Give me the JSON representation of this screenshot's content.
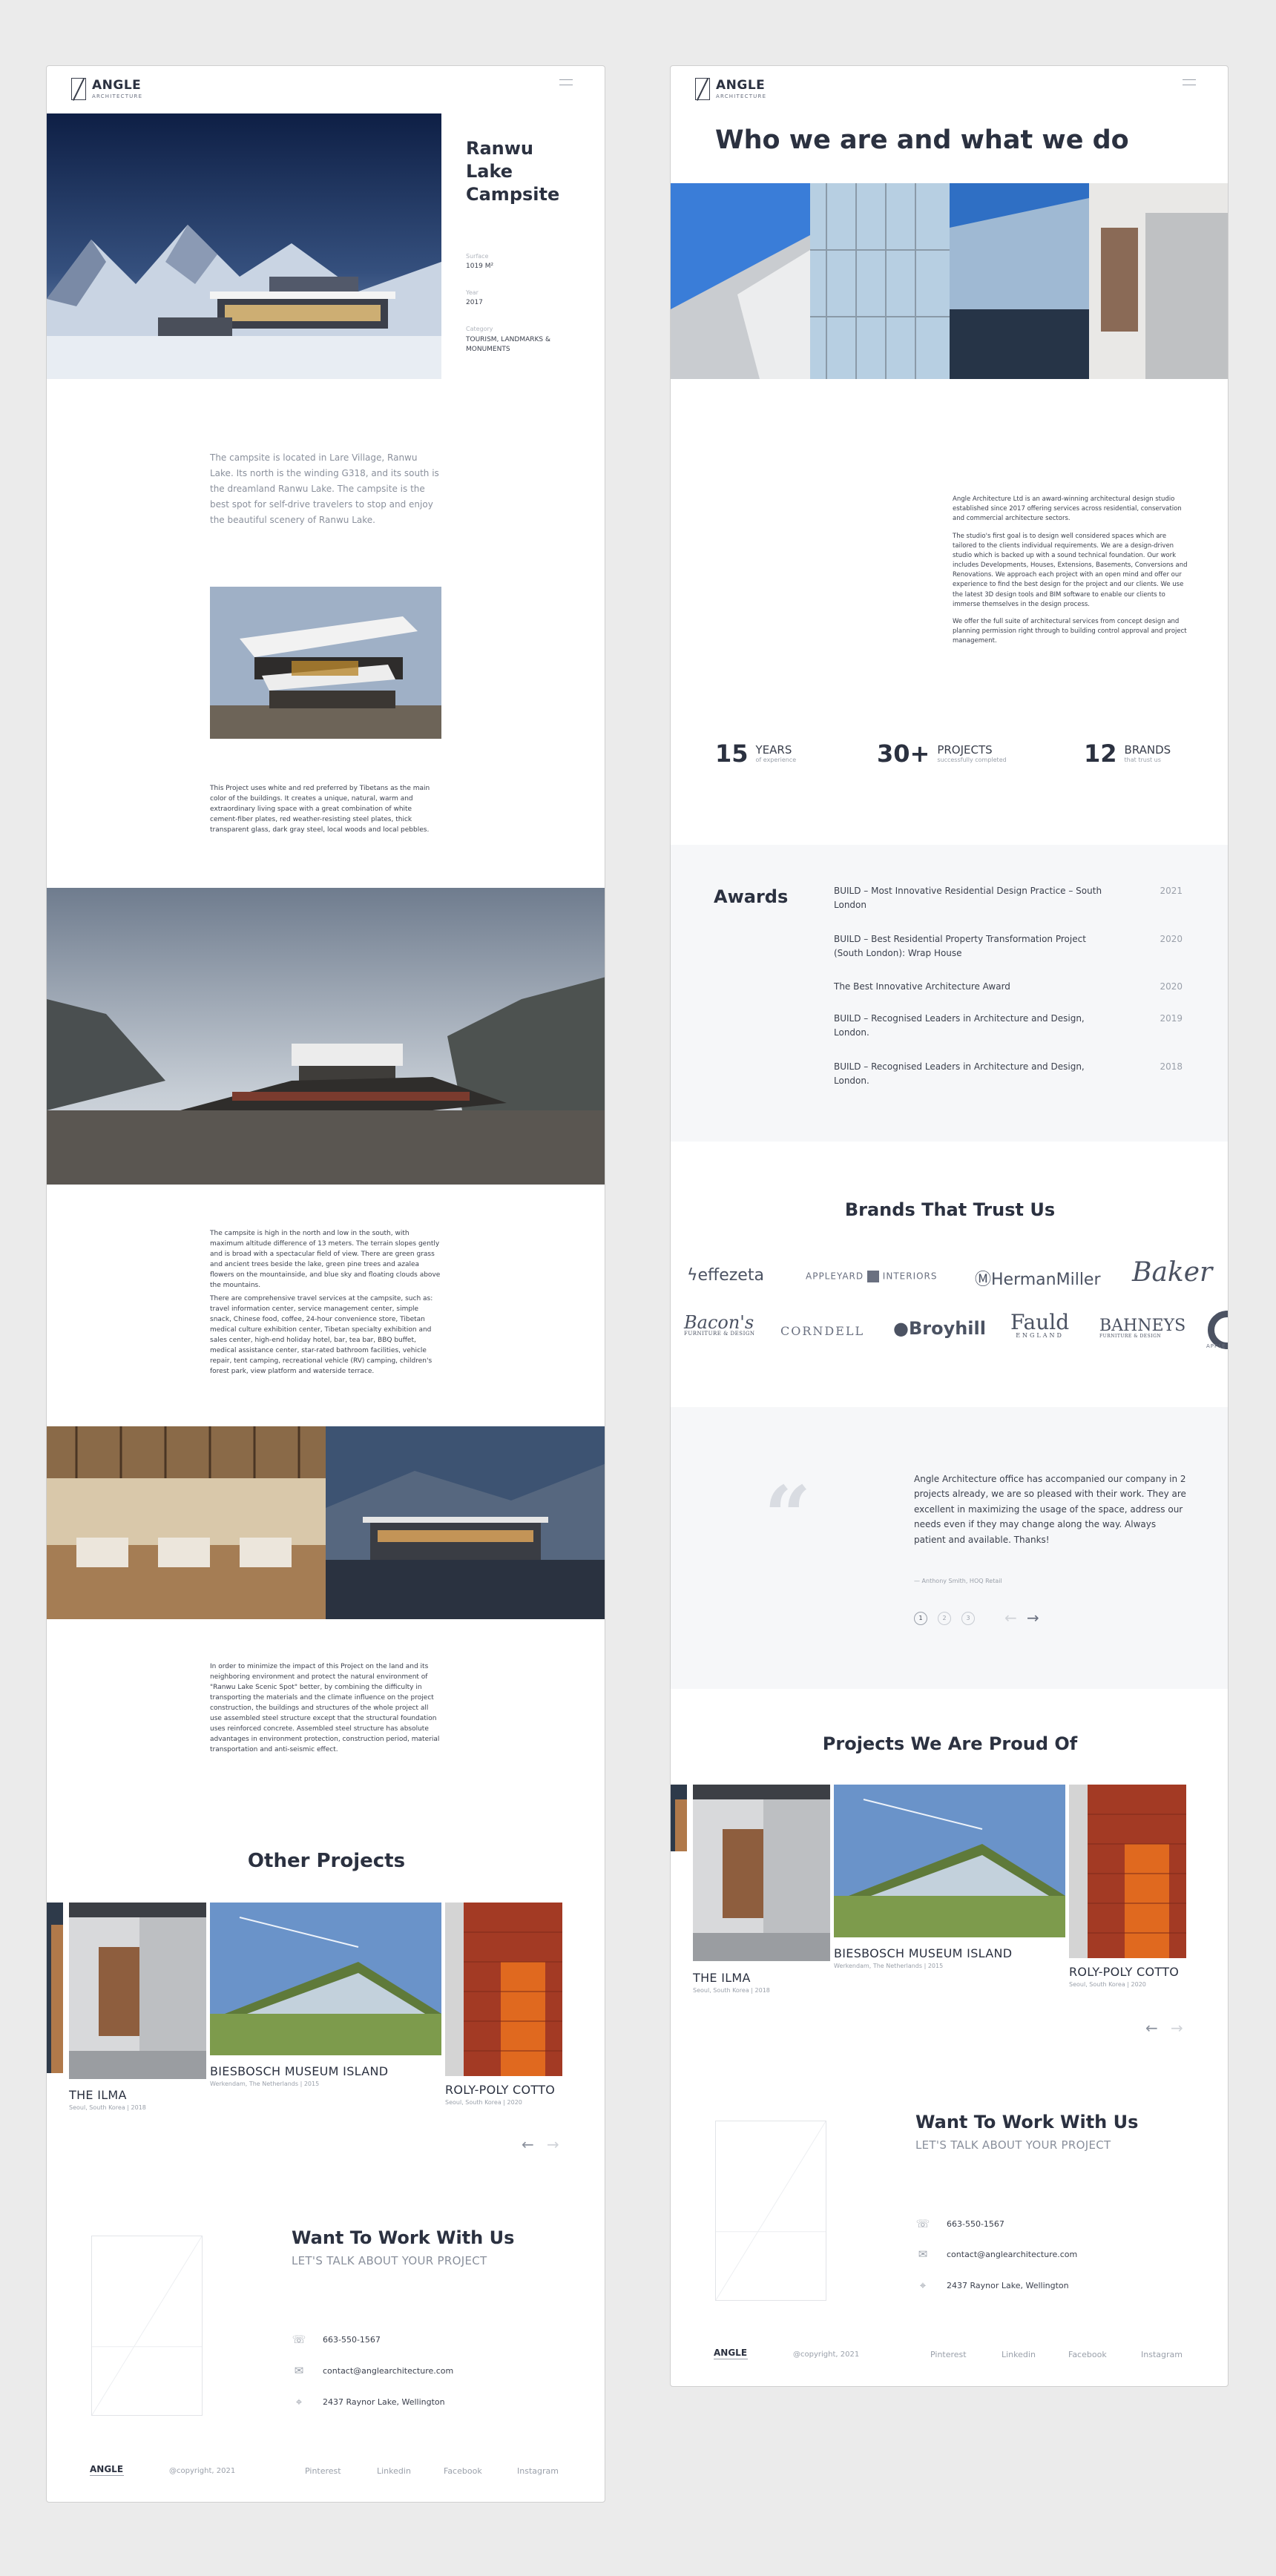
{
  "left": {
    "logo": {
      "title": "ANGLE",
      "sub": "ARCHITECTURE"
    },
    "project": {
      "title": "Ranwu Lake Campsite",
      "meta": [
        {
          "label": "Surface",
          "value": "1019 M²"
        },
        {
          "label": "Year",
          "value": "2017"
        },
        {
          "label": "Category",
          "value": "TOURISM, LANDMARKS & MONUMENTS"
        }
      ],
      "intro": "The campsite is located in Lare Village, Ranwu Lake. Its north is the winding G318, and its south is the dreamland Ranwu Lake. The campsite is the best spot for self-drive travelers to stop and enjoy the beautiful scenery of Ranwu Lake.",
      "para1": "This Project uses white and red preferred by Tibetans as the main color of the buildings. It creates a unique, natural, warm and extraordinary living space with a great combination of white cement-fiber plates, red weather-resisting steel plates, thick transparent glass, dark gray steel, local woods and local pebbles.",
      "para2a": "The campsite is high in the north and low in the south, with maximum altitude difference of 13 meters. The terrain slopes gently and is broad with a spectacular field of view. There are green grass and ancient trees beside the lake, green pine trees and azalea flowers on the mountainside, and blue sky and floating clouds above the mountains.",
      "para2b": "There are comprehensive travel services at the campsite, such as: travel information center, service management center, simple snack, Chinese food, coffee, 24-hour convenience store, Tibetan medical culture exhibition center, Tibetan specialty exhibition and sales center, high-end holiday hotel, bar, tea bar, BBQ buffet, medical assistance center, star-rated bathroom facilities, vehicle repair, tent camping, recreational vehicle (RV) camping, children's forest park, view platform and waterside terrace.",
      "para3": "In order to minimize the impact of this Project on the land and its neighboring environment and protect the natural environment of \"Ranwu Lake Scenic Spot\" better, by combining the difficulty in transporting the materials and the climate influence on the project construction, the buildings and structures of the whole project all use assembled steel structure except that the structural foundation uses reinforced concrete. Assembled steel structure has absolute advantages in environment protection, construction period, material transportation and anti-seismic effect."
    },
    "other": {
      "heading": "Other Projects",
      "items": [
        {
          "title": "THE ILMA",
          "sub": "Seoul, South Korea  |  2018"
        },
        {
          "title": "BIESBOSCH MUSEUM ISLAND",
          "sub": "Werkendam, The Netherlands  |  2015"
        },
        {
          "title": "ROLY-POLY COTTO",
          "sub": "Seoul, South Korea  |  2020"
        }
      ],
      "prev": "←",
      "next": "→"
    },
    "cta": {
      "title": "Want To Work With Us",
      "sub": "LET'S TALK ABOUT YOUR PROJECT",
      "phone": "663-550-1567",
      "email": "contact@anglearchitecture.com",
      "address": "2437 Raynor Lake, Wellington"
    },
    "footer": {
      "logo": "ANGLE",
      "copyright": "@copyright, 2021",
      "links": [
        "Pinterest",
        "Linkedin",
        "Facebook",
        "Instagram"
      ]
    }
  },
  "right": {
    "logo": {
      "title": "ANGLE",
      "sub": "ARCHITECTURE"
    },
    "hero_title": "Who we are and what we do",
    "about": [
      "Angle Architecture Ltd is an award-winning architectural design studio established since 2017 offering services across residential, conservation and commercial architecture sectors.",
      "The studio's first goal is to design well considered spaces which are tailored to the clients individual requirements. We are a design-driven studio which is backed up with a sound technical foundation. Our work includes Developments, Houses, Extensions, Basements, Conversions and Renovations. We approach each project with an open mind and offer our experience to find the best design for the project and our clients.  We use the latest 3D design tools and BIM software to enable our clients to immerse themselves in the design process.",
      "We offer the full suite of architectural services from concept design and planning permission right through to building control approval and project management."
    ],
    "stats": [
      {
        "num": "15",
        "label": "YEARS",
        "sub": "of experience"
      },
      {
        "num": "30+",
        "label": "PROJECTS",
        "sub": "successfully completed"
      },
      {
        "num": "12",
        "label": "BRANDS",
        "sub": "that trust us"
      }
    ],
    "awards": {
      "heading": "Awards",
      "items": [
        {
          "title": "BUILD – Most Innovative Residential Design Practice – South London",
          "year": "2021"
        },
        {
          "title": "BUILD – Best Residential Property Transformation Project (South London): Wrap House",
          "year": "2020"
        },
        {
          "title": "The Best Innovative Architecture Award",
          "year": "2020"
        },
        {
          "title": "BUILD – Recognised Leaders in Architecture and Design, London.",
          "year": "2019"
        },
        {
          "title": "BUILD – Recognised Leaders in Architecture and Design, London.",
          "year": "2018"
        }
      ]
    },
    "brands": {
      "heading": "Brands That Trust Us",
      "row1": [
        "effezeta",
        "APPLEYARD",
        "INTERIORS",
        "HermanMiller",
        "Baker"
      ],
      "row2": [
        "Bacon's",
        "FURNITURE & DESIGN",
        "CORNDELL",
        "Broyhill",
        "Fauld",
        "ENGLAND",
        "BAHNEYS",
        "FURNITURE & DESIGN",
        "APPLE"
      ]
    },
    "testimonial": {
      "quote": "Angle Architecture office has accompanied our company in 2 projects already, we are so pleased with their work. They are excellent in maximizing the usage of the space, address our needs even if they may change along the way. Always patient and available. Thanks!",
      "author": "— Anthony Smith, HOQ Retail",
      "pages": [
        "1",
        "2",
        "3"
      ],
      "prev": "←",
      "next": "→"
    },
    "projects": {
      "heading": "Projects We Are Proud Of",
      "items": [
        {
          "title": "THE ILMA",
          "sub": "Seoul, South Korea  |  2018"
        },
        {
          "title": "BIESBOSCH MUSEUM ISLAND",
          "sub": "Werkendam, The Netherlands  |  2015"
        },
        {
          "title": "ROLY-POLY COTTO",
          "sub": "Seoul, South Korea  |  2020"
        }
      ],
      "prev": "←",
      "next": "→"
    },
    "cta": {
      "title": "Want To Work With Us",
      "sub": "LET'S TALK ABOUT YOUR PROJECT",
      "phone": "663-550-1567",
      "email": "contact@anglearchitecture.com",
      "address": "2437 Raynor Lake, Wellington"
    },
    "footer": {
      "logo": "ANGLE",
      "copyright": "@copyright, 2021",
      "links": [
        "Pinterest",
        "Linkedin",
        "Facebook",
        "Instagram"
      ]
    }
  }
}
